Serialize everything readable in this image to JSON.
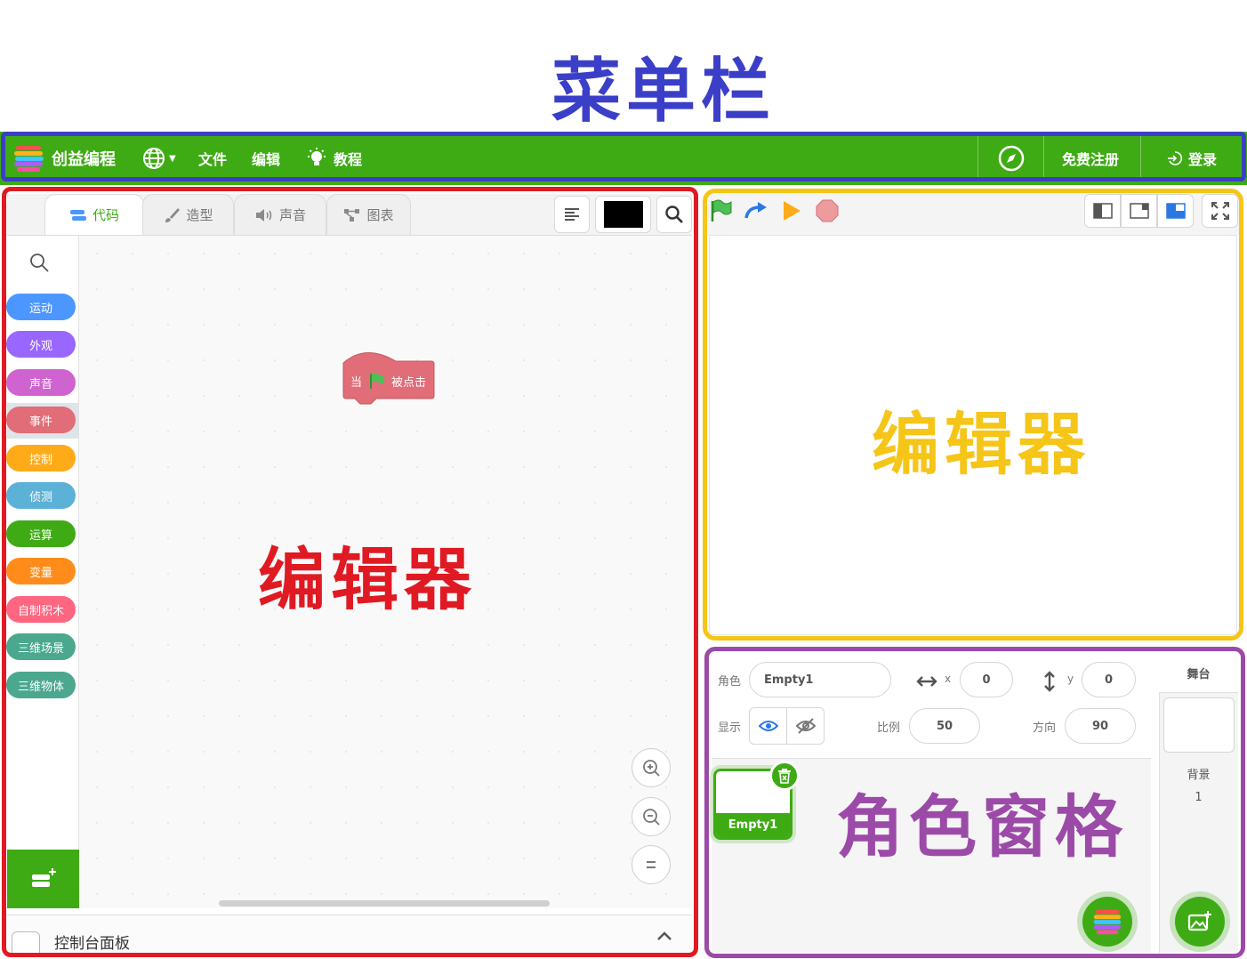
{
  "annotations": {
    "menubar": "菜单栏",
    "code_editor": "编辑器",
    "stage_editor": "编辑器",
    "sprite_pane": "角色窗格"
  },
  "colors": {
    "menubar_bg": "#3eab14",
    "menubar_annotation": "#3b3fc8",
    "code_annotation": "#e01a23",
    "stage_annotation": "#f5c518",
    "sprite_annotation": "#9c4aa8"
  },
  "menubar": {
    "brand": "创益编程",
    "globe_icon": "globe-icon",
    "file": "文件",
    "edit": "编辑",
    "tutorial": "教程",
    "signup": "免费注册",
    "login": "登录"
  },
  "tabs": [
    {
      "label": "代码",
      "icon": "code-blocks-icon"
    },
    {
      "label": "造型",
      "icon": "brush-icon"
    },
    {
      "label": "声音",
      "icon": "speaker-icon"
    },
    {
      "label": "图表",
      "icon": "chart-icon"
    }
  ],
  "categories": [
    {
      "label": "运动",
      "color": "#4c97ff"
    },
    {
      "label": "外观",
      "color": "#9966ff"
    },
    {
      "label": "声音",
      "color": "#cf63cf"
    },
    {
      "label": "事件",
      "color": "#e06d77"
    },
    {
      "label": "控制",
      "color": "#ffab19"
    },
    {
      "label": "侦测",
      "color": "#5cb1d6"
    },
    {
      "label": "运算",
      "color": "#3eab14"
    },
    {
      "label": "变量",
      "color": "#ff8c1a"
    },
    {
      "label": "自制积木",
      "color": "#ff6680"
    },
    {
      "label": "三维场景",
      "color": "#4ba88f"
    },
    {
      "label": "三维物体",
      "color": "#4ba88f"
    }
  ],
  "block": {
    "prefix": "当",
    "suffix": "被点击",
    "color": "#e06d77"
  },
  "console": {
    "label": "控制台面板"
  },
  "sprite_info": {
    "sprite_label": "角色",
    "sprite_name": "Empty1",
    "x_label": "x",
    "x_value": "0",
    "y_label": "y",
    "y_value": "0",
    "show_label": "显示",
    "scale_label": "比例",
    "scale_value": "50",
    "direction_label": "方向",
    "direction_value": "90"
  },
  "sprite_list": [
    {
      "name": "Empty1"
    }
  ],
  "stage_panel": {
    "title": "舞台",
    "backdrop_label": "背景",
    "backdrop_count": "1"
  }
}
